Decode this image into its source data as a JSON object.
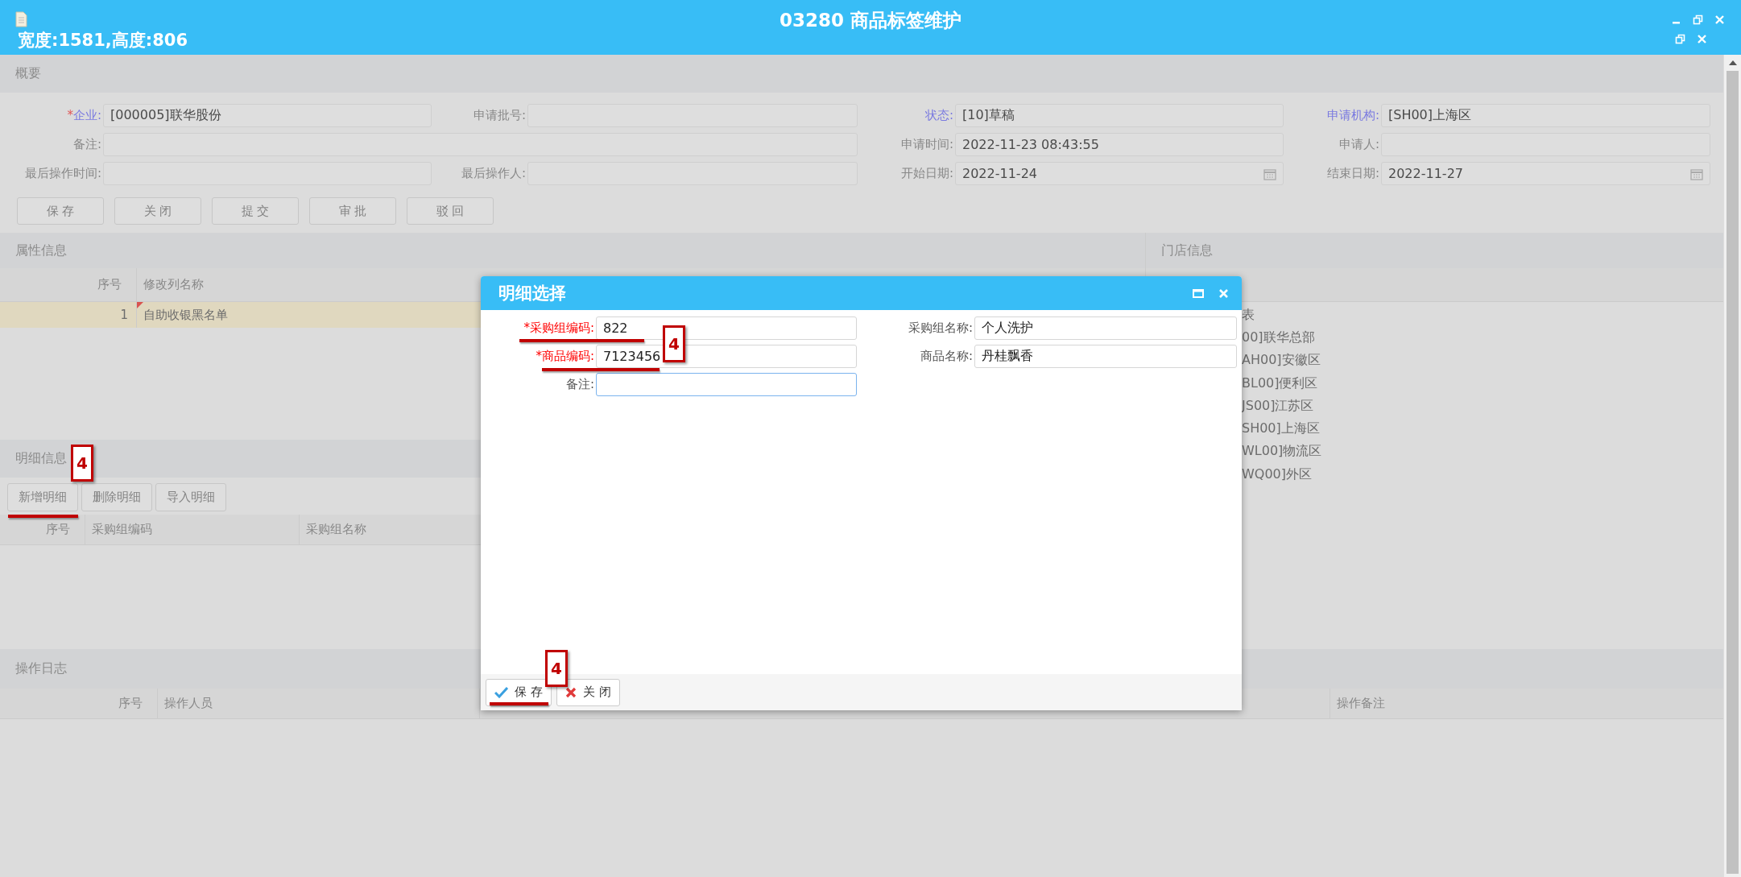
{
  "window": {
    "title": "03280 商品标签维护",
    "subtitle": "宽度:1581,高度:806"
  },
  "overview": {
    "title": "概要",
    "fields": [
      {
        "required_mark": "*",
        "label": "企业:",
        "value": "[000005]联华股份",
        "linked": true,
        "kind": "text"
      },
      {
        "label": "申请批号:",
        "linked": false,
        "kind": "text"
      },
      {
        "label": "状态:",
        "value": "[10]草稿",
        "linked": true,
        "kind": "text"
      },
      {
        "label": "申请机构:",
        "value": "[SH00]上海区",
        "linked": true,
        "kind": "text"
      },
      {
        "label": "备注:",
        "linked": false,
        "kind": "wide"
      },
      {
        "label": "申请时间:",
        "value": "2022-11-23 08:43:55",
        "linked": false,
        "kind": "text"
      },
      {
        "label": "申请人:",
        "linked": false,
        "kind": "text"
      },
      {
        "label": "最后操作时间:",
        "linked": false,
        "kind": "text"
      },
      {
        "label": "最后操作人:",
        "linked": false,
        "kind": "text"
      },
      {
        "label": "开始日期:",
        "value": "2022-11-24",
        "linked": false,
        "kind": "date"
      },
      {
        "label": "结束日期:",
        "value": "2022-11-27",
        "linked": false,
        "kind": "date"
      }
    ],
    "buttons": [
      "保 存",
      "关 闭",
      "提 交",
      "审 批",
      "驳 回"
    ]
  },
  "attributes": {
    "title": "属性信息",
    "columns": [
      "序号",
      "修改列名称"
    ],
    "rows": [
      {
        "cells": [
          "1",
          "自助收银黑名单"
        ],
        "selected": true,
        "modified": true
      }
    ]
  },
  "details": {
    "title": "明细信息",
    "buttons": [
      "新增明细",
      "删除明细",
      "导入明细"
    ],
    "columns": [
      "序号",
      "采购组编码",
      "采购组名称"
    ]
  },
  "stores": {
    "title": "门店信息",
    "items": [
      "表",
      "00]联华总部",
      "AH00]安徽区",
      "BL00]便利区",
      "JS00]江苏区",
      "SH00]上海区",
      "WL00]物流区",
      "WQ00]外区"
    ]
  },
  "log": {
    "title": "操作日志",
    "columns": [
      "序号",
      "操作人员",
      "操作备注"
    ]
  },
  "dialog": {
    "title": "明细选择",
    "fields": [
      {
        "label": "*采购组编码:",
        "value": "822",
        "required": true,
        "focused": false
      },
      {
        "label": "采购组名称:",
        "value": "个人洗护",
        "required": false,
        "focused": false
      },
      {
        "label": "*商品编码:",
        "value": "7123456",
        "required": true,
        "focused": false
      },
      {
        "label": "商品名称:",
        "value": "丹桂飘香",
        "required": false,
        "focused": false
      },
      {
        "label": "备注:",
        "required": false,
        "focused": true
      }
    ],
    "buttons": [
      {
        "label": "保 存",
        "kind": "save"
      },
      {
        "label": "关 闭",
        "kind": "close"
      }
    ]
  },
  "annotations": [
    {
      "label": "4"
    },
    {
      "label": "4"
    },
    {
      "label": "4"
    }
  ]
}
